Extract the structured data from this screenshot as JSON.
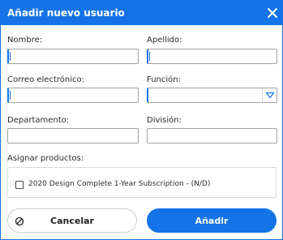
{
  "dialog": {
    "title": "Añadir nuevo usuario",
    "close_icon": "close-icon"
  },
  "form": {
    "first_name": {
      "label": "Nombre:",
      "value": ""
    },
    "last_name": {
      "label": "Apellido:",
      "value": ""
    },
    "email": {
      "label": "Correo electrónico:",
      "value": ""
    },
    "role": {
      "label": "Función:",
      "value": "",
      "icon": "triangle-down-icon"
    },
    "department": {
      "label": "Departamento:",
      "value": ""
    },
    "division": {
      "label": "División:",
      "value": ""
    }
  },
  "products": {
    "label": "Asignar productos:",
    "items": [
      {
        "label": "2020 Design Complete 1-Year Subscription - (N/D)",
        "checked": false
      }
    ]
  },
  "actions": {
    "cancel_label": "Cancelar",
    "cancel_icon": "cancel-circle-icon",
    "add_label": "Añadir"
  },
  "colors": {
    "accent": "#1473e6",
    "border": "#9ea3a8"
  }
}
